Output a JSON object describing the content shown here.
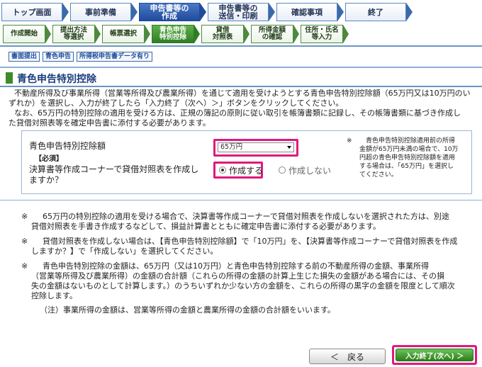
{
  "main_steps": [
    {
      "label": "トップ画面",
      "active": false
    },
    {
      "label": "事前準備",
      "active": false
    },
    {
      "label": "申告書等の\n作成",
      "active": true
    },
    {
      "label": "申告書等の\n送信・印刷",
      "active": false
    },
    {
      "label": "確認事項",
      "active": false
    },
    {
      "label": "終了",
      "active": false
    }
  ],
  "sub_steps": [
    {
      "label": "作成開始",
      "active": false
    },
    {
      "label": "提出方法\n等選択",
      "active": false
    },
    {
      "label": "帳票選択",
      "active": false
    },
    {
      "label": "青色申告\n特別控除",
      "active": true
    },
    {
      "label": "貸借\n対照表",
      "active": false
    },
    {
      "label": "所得金額\nの確認",
      "active": false
    },
    {
      "label": "住所・氏名\n等入力",
      "active": false
    }
  ],
  "tags": [
    "書面提出",
    "青色申告",
    "所得税申告書データ有り"
  ],
  "section_title": "青色申告特別控除",
  "intro": {
    "line1": "不動産所得及び事業所得（営業等所得及び農業所得）を通じて適用を受けようとする青色申告特別控除額（65万円又は10万円のい",
    "line2": "ずれか）を選択し、入力が終了したら「入力終了（次へ）＞」ボタンをクリックしてください。",
    "line3": "なお、65万円の特別控除の適用を受ける方は、正規の簿記の原則に従い取引を帳簿書類に記録し、その帳簿書類に基づき作成し",
    "line4": "た貸借対照表等を確定申告書に添付する必要があります。"
  },
  "form": {
    "deduction_label": "青色申告特別控除額",
    "required_label": "【必須】",
    "deduction_value": "65万円",
    "balance_question_line1": "決算書等作成コーナーで貸借対照表を作成し",
    "balance_question_line2": "ますか？",
    "option_create": "作成する",
    "option_not_create": "作成しない",
    "side_mark": "※",
    "side_note_1": "青色申告特別控除適用前の所得",
    "side_note_2": "金額が65万円未満の場合で、10万",
    "side_note_3": "円超の青色申告特別控除額を適用",
    "side_note_4": "する場合は、「65万円」を選択し",
    "side_note_5": "てください。"
  },
  "notes": {
    "mark": "※",
    "n1_line1": "65万円の特別控除の適用を受ける場合で、決算書等作成コーナーで貸借対照表を作成しないを選択された方は、別途",
    "n1_line2": "貸借対照表を手書き作成するなどして、損益計算書とともに確定申告書に添付する必要があります。",
    "n2_line1": "貸借対照表を作成しない場合は、【青色申告特別控除額】で「10万円」を、【決算書等作成コーナーで貸借対照表を作成",
    "n2_line2": "しますか？】で「作成しない」を選択してください。",
    "n3_line1": "青色申告特別控除の金額は、65万円（又は10万円）と青色申告特別控除する前の不動産所得の金額、事業所得",
    "n3_line2": "（営業等所得及び農業所得）の金額の合計額（これらの所得の金額の計算上生じた損失の金額がある場合には、その損",
    "n3_line3": "失の金額はないものとして計算します。）のうちいずれか少ない方の金額を、これらの所得の黒字の金額を限度として順次",
    "n3_line4": "控除します。",
    "n4": "（注）事業所得の金額は、営業等所得の金額と農業所得の金額の合計額をいいます。"
  },
  "buttons": {
    "back_arrow": "＜",
    "back_label": "戻る",
    "next_label": "入力終了(次へ) ＞"
  }
}
